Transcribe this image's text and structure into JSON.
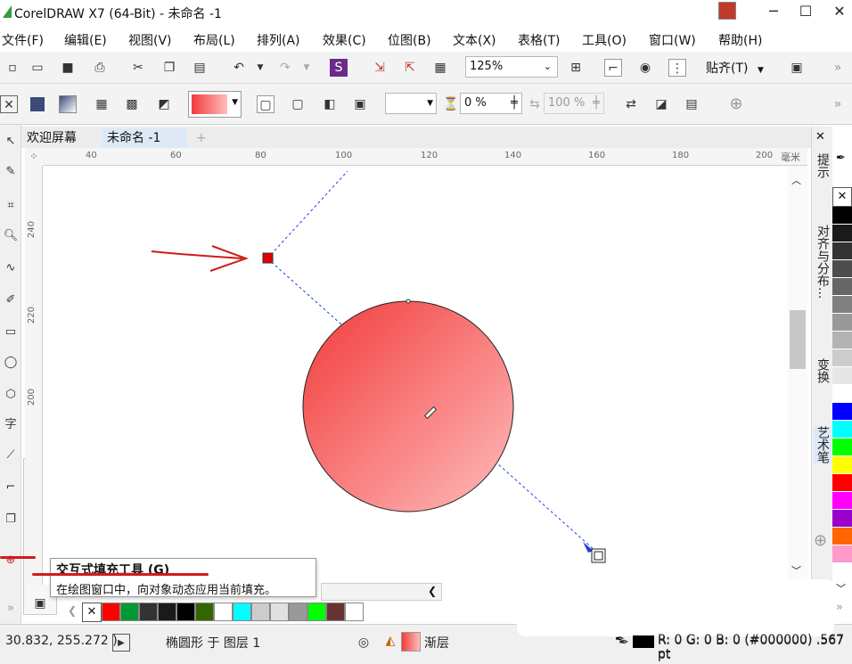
{
  "window": {
    "title": "CorelDRAW X7 (64-Bit) - 未命名 -1",
    "controls": [
      "─",
      "☐",
      "✕"
    ]
  },
  "menu": [
    "文件(F)",
    "编辑(E)",
    "视图(V)",
    "布局(L)",
    "排列(A)",
    "效果(C)",
    "位图(B)",
    "文本(X)",
    "表格(T)",
    "工具(O)",
    "窗口(W)",
    "帮助(H)"
  ],
  "toolbar": {
    "zoom": "125%",
    "snap": "贴齐(T)"
  },
  "propbar": {
    "transparency": "0 %",
    "midpoint": "100 %"
  },
  "tabs": [
    "欢迎屏幕",
    "未命名 -1"
  ],
  "ruler": {
    "h_ticks": [
      "40",
      "60",
      "80",
      "100",
      "120",
      "140",
      "160",
      "180",
      "200"
    ],
    "unit": "毫米",
    "v_ticks": [
      "240",
      "220",
      "200"
    ]
  },
  "tooltip": {
    "title": "交互式填充工具 (G)",
    "description": "在绘图窗口中，向对象动态应用当前填充。"
  },
  "dockers": [
    "提示",
    "对齐与分布...",
    "变换",
    "艺术笔"
  ],
  "fill": {
    "gradient_start": "#f23b3b",
    "gradient_end": "#ffbcbc"
  },
  "palette_vertical": [
    "#000000",
    "#1a1a1a",
    "#333333",
    "#4d4d4d",
    "#666666",
    "#808080",
    "#999999",
    "#b3b3b3",
    "#cccccc",
    "#e6e6e6",
    "#ffffff",
    "#0000ff",
    "#00ffff",
    "#00ff00",
    "#ffff00",
    "#ff0000",
    "#ff00ff",
    "#9900cc",
    "#ff6600",
    "#ff99cc"
  ],
  "palette_horizontal": [
    "#ff0000",
    "#009933",
    "#333333",
    "#1a1a1a",
    "#000000",
    "#336600",
    "#ffffff",
    "#00ffff",
    "#cccccc",
    "#e0e0e0",
    "#999999",
    "#00ff00",
    "#663333",
    "#ffffff"
  ],
  "status": {
    "coords": "30.832, 255.272 )",
    "object": "椭圆形 于 图层 1",
    "fill_label": "渐层",
    "outline": "R: 0 G: 0 B: 0 (#000000) .567 pt"
  }
}
